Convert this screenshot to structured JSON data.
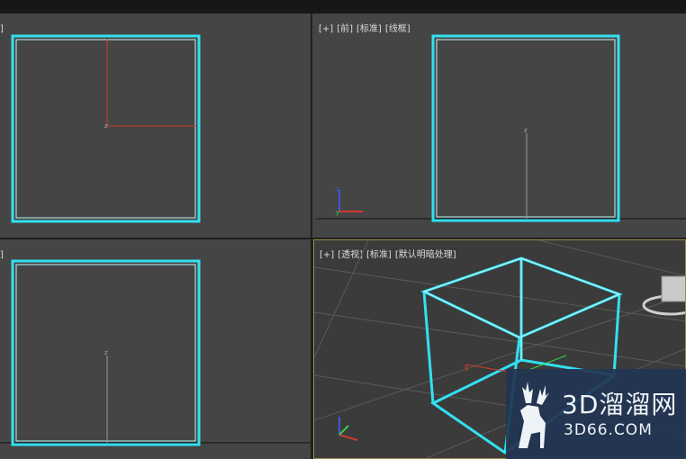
{
  "viewports": {
    "top_left": {
      "label_fragment": "]"
    },
    "top_right": {
      "labels": [
        "[+]",
        "[前]",
        "[标准]",
        "[线框]"
      ],
      "axis_label": "z"
    },
    "bottom_left": {
      "label_fragment": "]",
      "axis_label": "z"
    },
    "bottom_right": {
      "labels": [
        "[+]",
        "[透视]",
        "[标准]",
        "[默认明暗处理]"
      ]
    }
  },
  "watermark": {
    "brand": "3D溜溜网",
    "url": "3D66.COM"
  },
  "colors": {
    "wireframe": "#32e0f0",
    "viewport_bg": "#454545",
    "active_border": "#9b8b4a",
    "axis_x": "#d23a2e",
    "axis_y": "#3ad24a",
    "axis_z": "#3a5ad2",
    "watermark_bg": "#223553"
  }
}
